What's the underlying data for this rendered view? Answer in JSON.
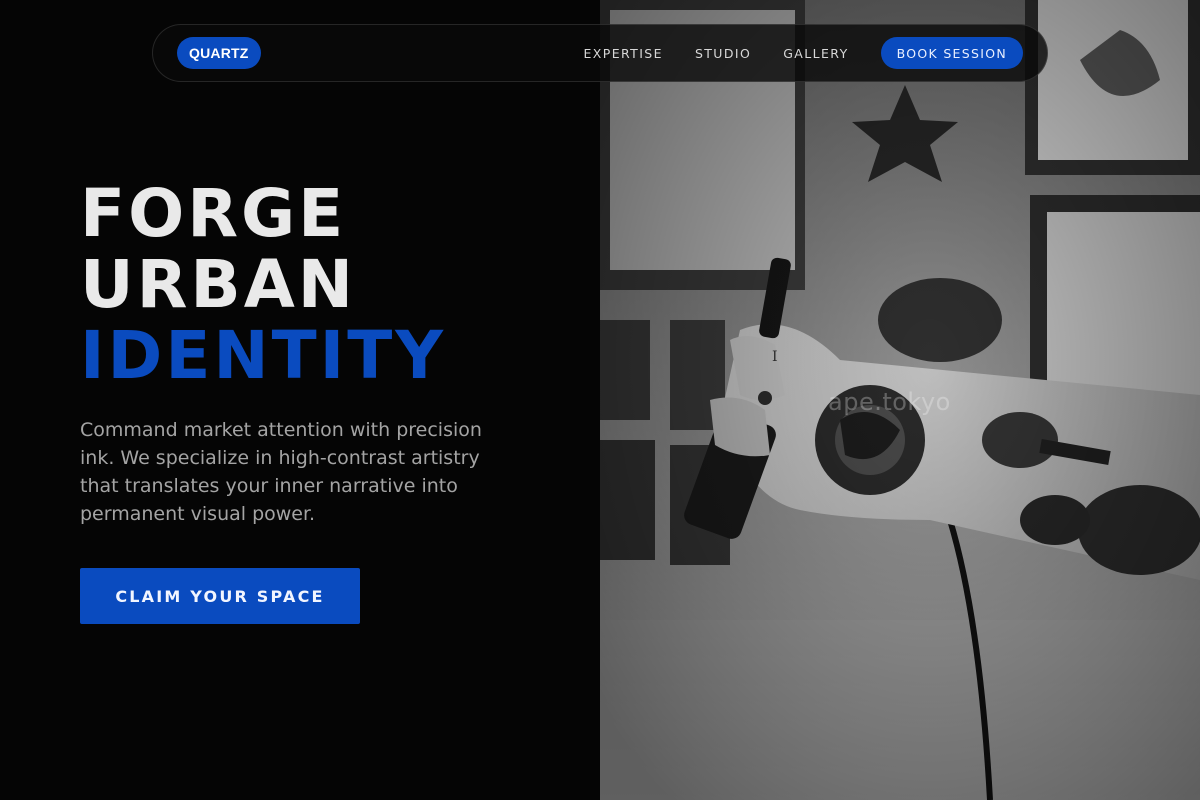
{
  "brand": {
    "logo_text": "QUARTZ"
  },
  "nav": {
    "links": [
      "EXPERTISE",
      "STUDIO",
      "GALLERY"
    ],
    "cta_label": "BOOK SESSION"
  },
  "hero": {
    "title_lines": [
      "FORGE",
      "URBAN",
      "IDENTITY"
    ],
    "body": "Command market attention with precision ink. We specialize in high-contrast artistry that translates your inner narrative into permanent visual power.",
    "cta_label": "CLAIM YOUR SPACE"
  },
  "photo": {
    "subject": "tattooed forearm holding a tattoo machine, black and white",
    "watermark": "ape.tokyo"
  },
  "colors": {
    "accent": "#0a4bbf",
    "background": "#050505",
    "heading": "#e9e9e9",
    "body_text": "#a4a4a4"
  }
}
